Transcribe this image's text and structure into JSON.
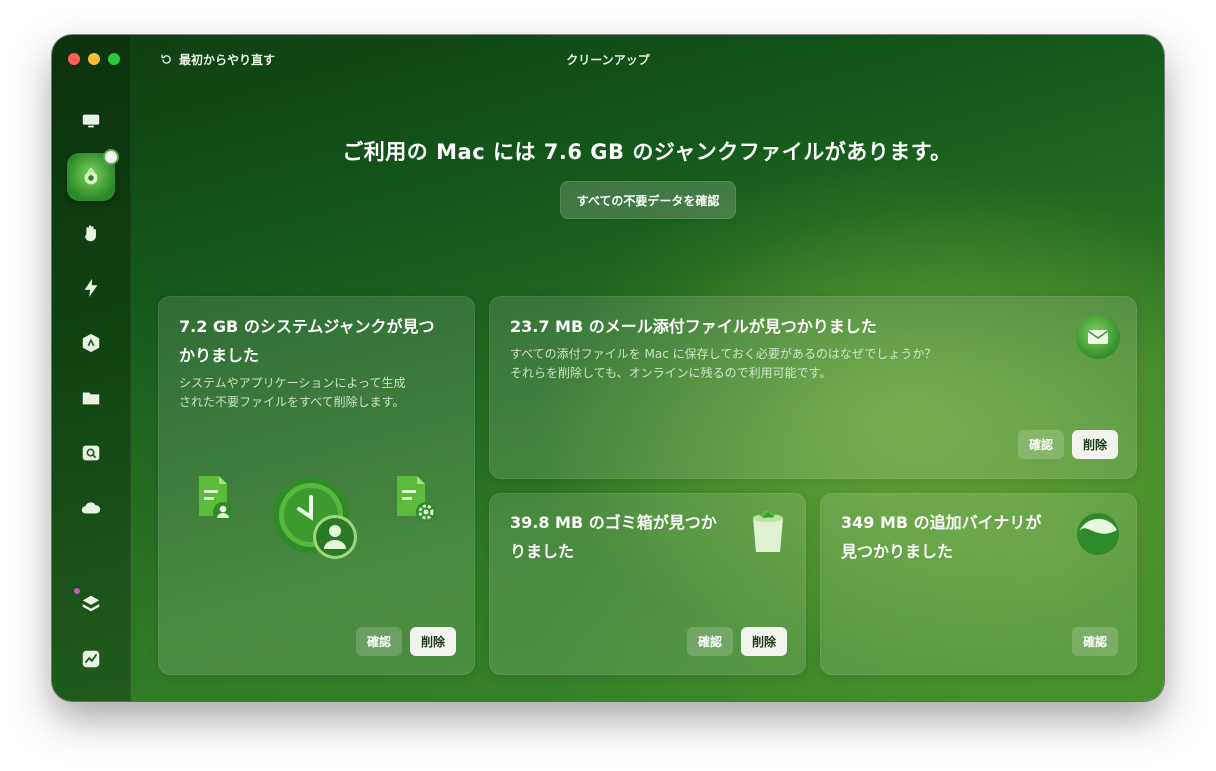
{
  "window": {
    "title": "クリーンアップ",
    "restart_label": "最初からやり直す"
  },
  "sidebar": {
    "items": [
      {
        "icon": "monitor-icon"
      },
      {
        "icon": "cleanup-icon",
        "active": true
      },
      {
        "icon": "hand-icon"
      },
      {
        "icon": "lightning-icon"
      },
      {
        "icon": "apps-icon"
      },
      {
        "icon": "folder-icon"
      },
      {
        "icon": "search-drive-icon"
      },
      {
        "icon": "cloud-icon"
      },
      {
        "icon": "layers-icon"
      },
      {
        "icon": "chart-icon"
      }
    ]
  },
  "main": {
    "headline": "ご利用の Mac には 7.6 GB のジャンクファイルがあります。",
    "review_all_label": "すべての不要データを確認",
    "cards": {
      "system_junk": {
        "title_line1": "7.2 GB のシステムジャンクが見つ",
        "title_line2": "かりました",
        "desc_line1": "システムやアプリケーションによって生成",
        "desc_line2": "された不要ファイルをすべて削除します。",
        "review_label": "確認",
        "delete_label": "削除"
      },
      "mail_attachments": {
        "title": "23.7 MB のメール添付ファイルが見つかりました",
        "desc_line1": "すべての添付ファイルを Mac に保存しておく必要があるのはなぜでしょうか？",
        "desc_line2": "それらを削除しても、オンラインに残るので利用可能です。",
        "review_label": "確認",
        "delete_label": "削除"
      },
      "trash": {
        "title_line1": "39.8 MB のゴミ箱が見つか",
        "title_line2": "りました",
        "review_label": "確認",
        "delete_label": "削除"
      },
      "binaries": {
        "title_line1": "349 MB の追加バイナリが",
        "title_line2": "見つかりました",
        "review_label": "確認"
      }
    }
  },
  "colors": {
    "accent_green": "#3a8a2a",
    "delete_button_bg": "#f2f2ee",
    "close": "#ff5f57",
    "minimize": "#febc2e",
    "zoom": "#28c840"
  }
}
